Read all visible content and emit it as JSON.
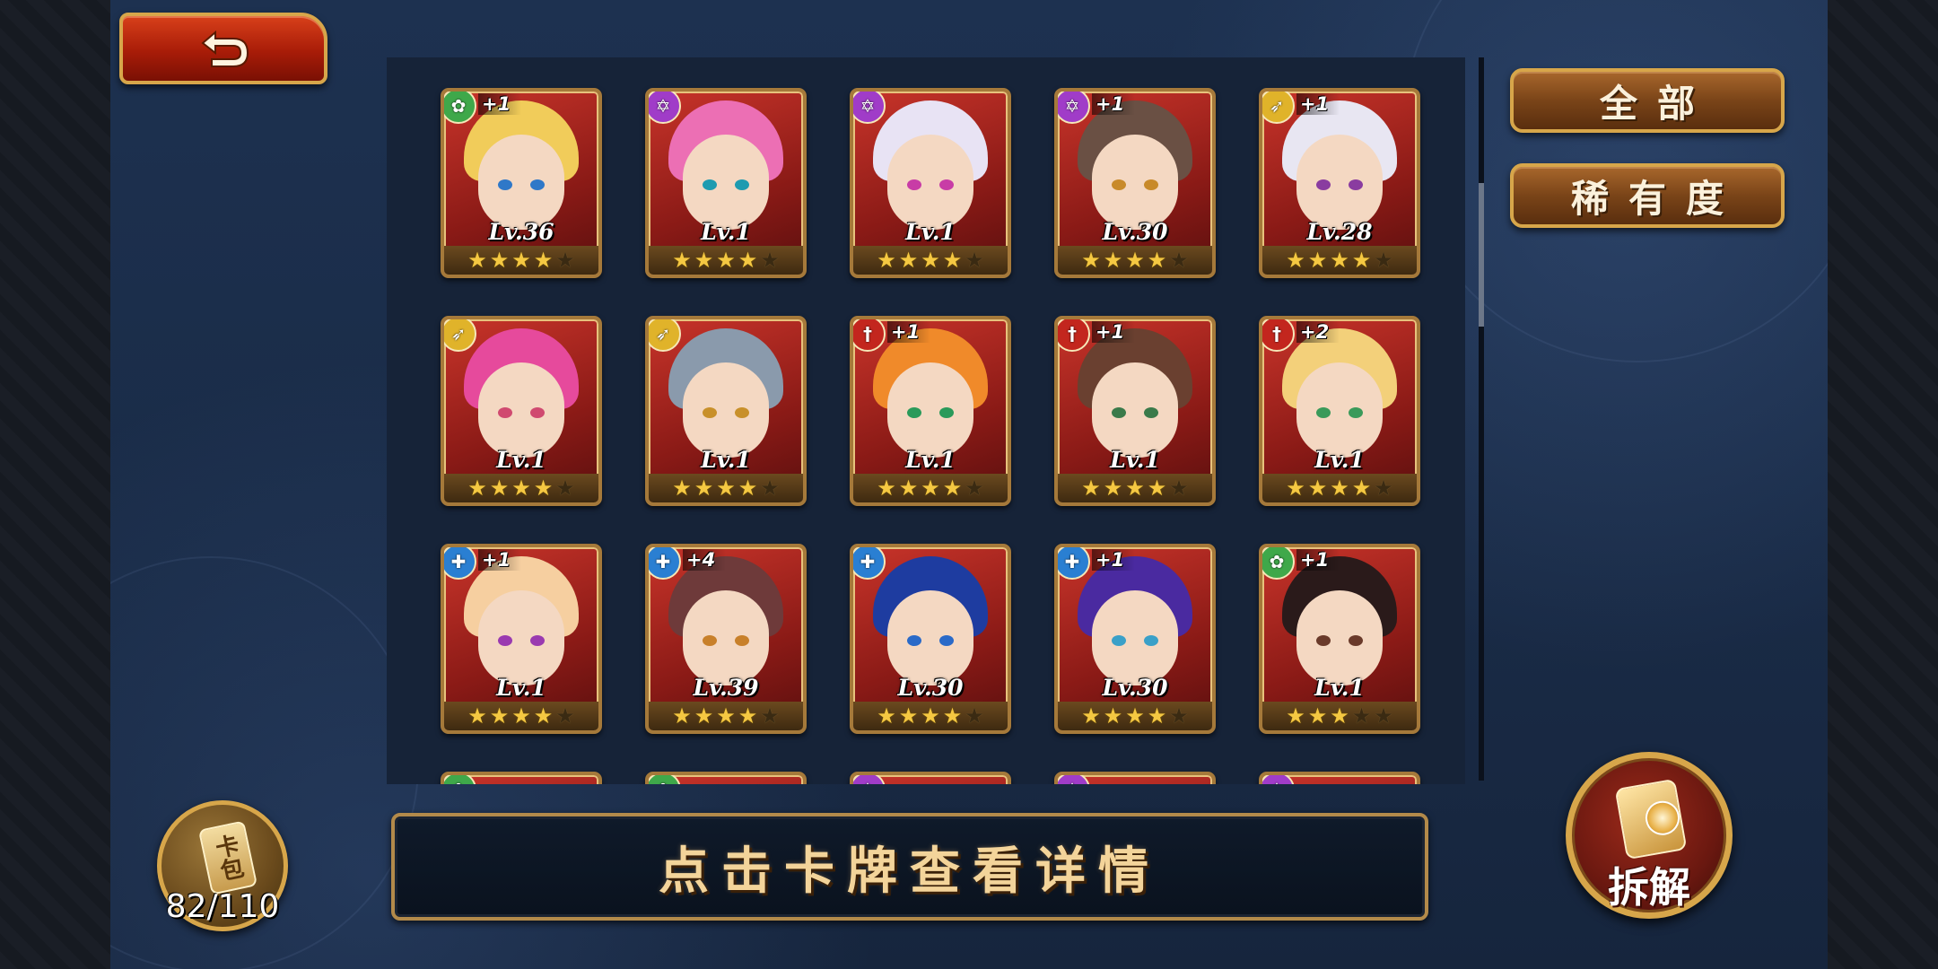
{
  "header": {
    "back_label": ""
  },
  "filters": {
    "all_label": "全部",
    "rarity_label": "稀有度"
  },
  "hint": {
    "text": "点击卡牌查看详情"
  },
  "card_pack": {
    "icon_text": "卡包",
    "count": "82/110"
  },
  "dismantle": {
    "label": "拆解"
  },
  "colors": {
    "element_green": "#3fa84a",
    "element_purple": "#a03cc8",
    "element_yellow": "#e0b32a",
    "element_red": "#c3261e",
    "element_blue": "#2a7fd2"
  },
  "cards": [
    {
      "element": "green",
      "element_icon": "leaf-icon",
      "plus": "+1",
      "level": "Lv.36",
      "stars": 4,
      "hair": "#f1cc5a",
      "eye": "#2f78c8"
    },
    {
      "element": "purple",
      "element_icon": "star-icon",
      "plus": "",
      "level": "Lv.1",
      "stars": 4,
      "hair": "#ec6fb4",
      "eye": "#1e9bb0"
    },
    {
      "element": "purple",
      "element_icon": "star-icon",
      "plus": "",
      "level": "Lv.1",
      "stars": 4,
      "hair": "#e8e3f4",
      "eye": "#c83ca6"
    },
    {
      "element": "purple",
      "element_icon": "star-icon",
      "plus": "+1",
      "level": "Lv.30",
      "stars": 4,
      "hair": "#6a5044",
      "eye": "#c88a2a"
    },
    {
      "element": "yellow",
      "element_icon": "bow-icon",
      "plus": "+1",
      "level": "Lv.28",
      "stars": 4,
      "hair": "#e8e6f2",
      "eye": "#8a3ca0"
    },
    {
      "element": "yellow",
      "element_icon": "bow-icon",
      "plus": "",
      "level": "Lv.1",
      "stars": 4,
      "hair": "#e64a9c",
      "eye": "#d04a70"
    },
    {
      "element": "yellow",
      "element_icon": "bow-icon",
      "plus": "",
      "level": "Lv.1",
      "stars": 4,
      "hair": "#8a9aac",
      "eye": "#c8902a"
    },
    {
      "element": "red",
      "element_icon": "sword-icon",
      "plus": "+1",
      "level": "Lv.1",
      "stars": 4,
      "hair": "#f08a2a",
      "eye": "#2a9a5a"
    },
    {
      "element": "red",
      "element_icon": "sword-icon",
      "plus": "+1",
      "level": "Lv.1",
      "stars": 4,
      "hair": "#6a4030",
      "eye": "#3a7a4a"
    },
    {
      "element": "red",
      "element_icon": "sword-icon",
      "plus": "+2",
      "level": "Lv.1",
      "stars": 4,
      "hair": "#f3d07a",
      "eye": "#3a9a5a"
    },
    {
      "element": "blue",
      "element_icon": "shield-icon",
      "plus": "+1",
      "level": "Lv.1",
      "stars": 4,
      "hair": "#f6cfa0",
      "eye": "#9a3ab0"
    },
    {
      "element": "blue",
      "element_icon": "shield-icon",
      "plus": "+4",
      "level": "Lv.39",
      "stars": 4,
      "hair": "#6e3a3a",
      "eye": "#c8802a"
    },
    {
      "element": "blue",
      "element_icon": "shield-icon",
      "plus": "",
      "level": "Lv.30",
      "stars": 4,
      "hair": "#1e3ca0",
      "eye": "#2a6ac8"
    },
    {
      "element": "blue",
      "element_icon": "shield-icon",
      "plus": "+1",
      "level": "Lv.30",
      "stars": 4,
      "hair": "#4a2aa0",
      "eye": "#3aa0c8"
    },
    {
      "element": "green",
      "element_icon": "leaf-icon",
      "plus": "+1",
      "level": "Lv.1",
      "stars": 3,
      "hair": "#2a1a1a",
      "eye": "#6a3a2a"
    },
    {
      "element": "green",
      "element_icon": "leaf-icon",
      "plus": "",
      "level": "",
      "stars": 0,
      "hair": "#7a5a80",
      "eye": "#333333"
    },
    {
      "element": "green",
      "element_icon": "leaf-icon",
      "plus": "",
      "level": "",
      "stars": 0,
      "hair": "#6a4a80",
      "eye": "#333333"
    },
    {
      "element": "purple",
      "element_icon": "star-icon",
      "plus": "",
      "level": "",
      "stars": 0,
      "hair": "#5a4a7a",
      "eye": "#333333"
    },
    {
      "element": "purple",
      "element_icon": "star-icon",
      "plus": "",
      "level": "",
      "stars": 0,
      "hair": "#4a5a7a",
      "eye": "#333333"
    },
    {
      "element": "purple",
      "element_icon": "star-icon",
      "plus": "",
      "level": "",
      "stars": 0,
      "hair": "#6a4a7a",
      "eye": "#333333"
    }
  ]
}
